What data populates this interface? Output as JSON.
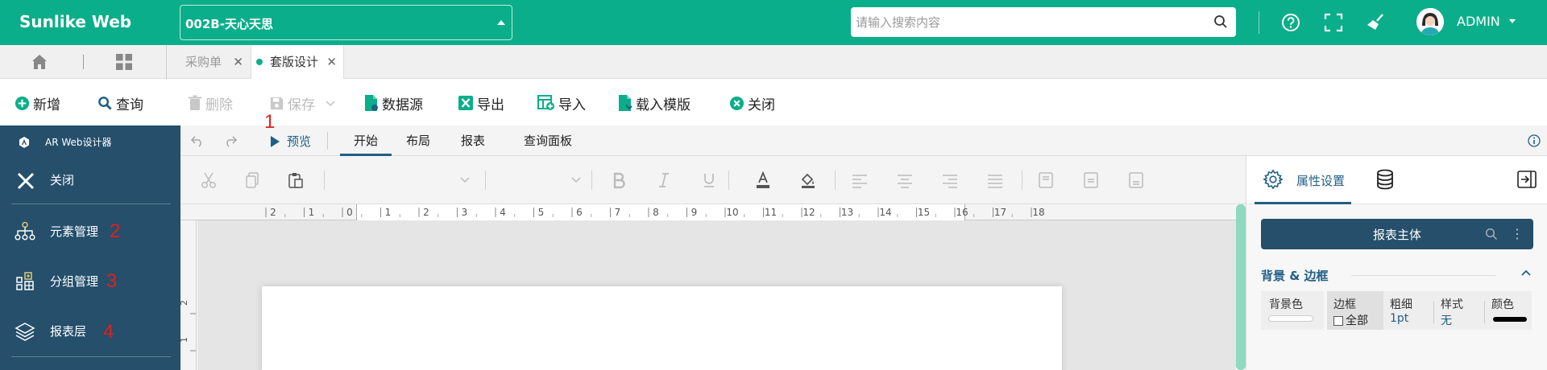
{
  "header": {
    "logo": "Sunlike Web",
    "company": "002B-天心天思",
    "search_placeholder": "请输入搜索内容",
    "user_name": "ADMIN",
    "colors": {
      "brand": "#0aae8a",
      "sidebar": "#254f6b",
      "accent": "#1f5e86"
    }
  },
  "tabs": [
    {
      "label": "采购单",
      "active": false
    },
    {
      "label": "套版设计",
      "active": true
    }
  ],
  "toolbar": {
    "new": "新增",
    "query": "查询",
    "delete": "删除",
    "save": "保存",
    "datasource": "数据源",
    "export": "导出",
    "import": "导入",
    "load_template": "载入模版",
    "close": "关闭"
  },
  "annotations": {
    "a1": "1",
    "a2": "2",
    "a3": "3",
    "a4": "4"
  },
  "sidebar": {
    "title": "AR Web设计器",
    "items": [
      {
        "label": "关闭",
        "icon": "close-icon"
      },
      {
        "label": "元素管理",
        "icon": "hierarchy-icon"
      },
      {
        "label": "分组管理",
        "icon": "group-icon"
      },
      {
        "label": "报表层",
        "icon": "layers-icon"
      }
    ]
  },
  "ribbon": {
    "preview": "预览",
    "tabs": [
      "开始",
      "布局",
      "报表",
      "查询面板"
    ]
  },
  "ruler": {
    "labels": [
      "2",
      "1",
      "0",
      "1",
      "2",
      "3",
      "4",
      "5",
      "6",
      "7",
      "8",
      "9",
      "10",
      "11",
      "12",
      "13",
      "14",
      "15",
      "16",
      "17",
      "18"
    ],
    "vertical_labels": [
      "2",
      "1"
    ]
  },
  "props": {
    "tab_label": "属性设置",
    "report_main": "报表主体",
    "section_title": "背景 & 边框",
    "bg_label": "背景色",
    "border_label": "边框",
    "border_all": "全部",
    "thickness_label": "粗细",
    "thickness_value": "1pt",
    "style_label": "样式",
    "style_value": "无",
    "color_label": "颜色"
  }
}
